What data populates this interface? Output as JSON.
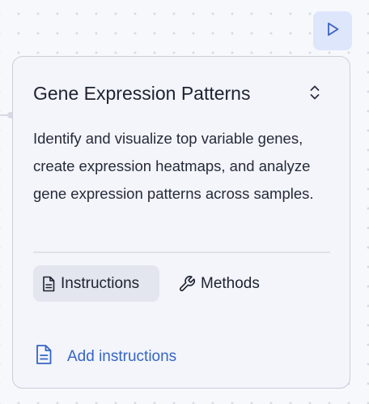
{
  "run_button": {
    "icon": "play-icon",
    "color": "#3e63c8"
  },
  "card": {
    "title": "Gene Expression Patterns",
    "collapse_icon": "chevron-up-down-icon",
    "description": "Identify and visualize top variable genes, create expression heatmaps, and analyze gene expression patterns across samples.",
    "tabs": [
      {
        "label": "Instructions",
        "icon": "document-icon",
        "active": true
      },
      {
        "label": "Methods",
        "icon": "wrench-icon",
        "active": false
      }
    ],
    "add_instructions": {
      "label": "Add instructions",
      "icon": "document-icon",
      "color": "#3665c4"
    }
  }
}
